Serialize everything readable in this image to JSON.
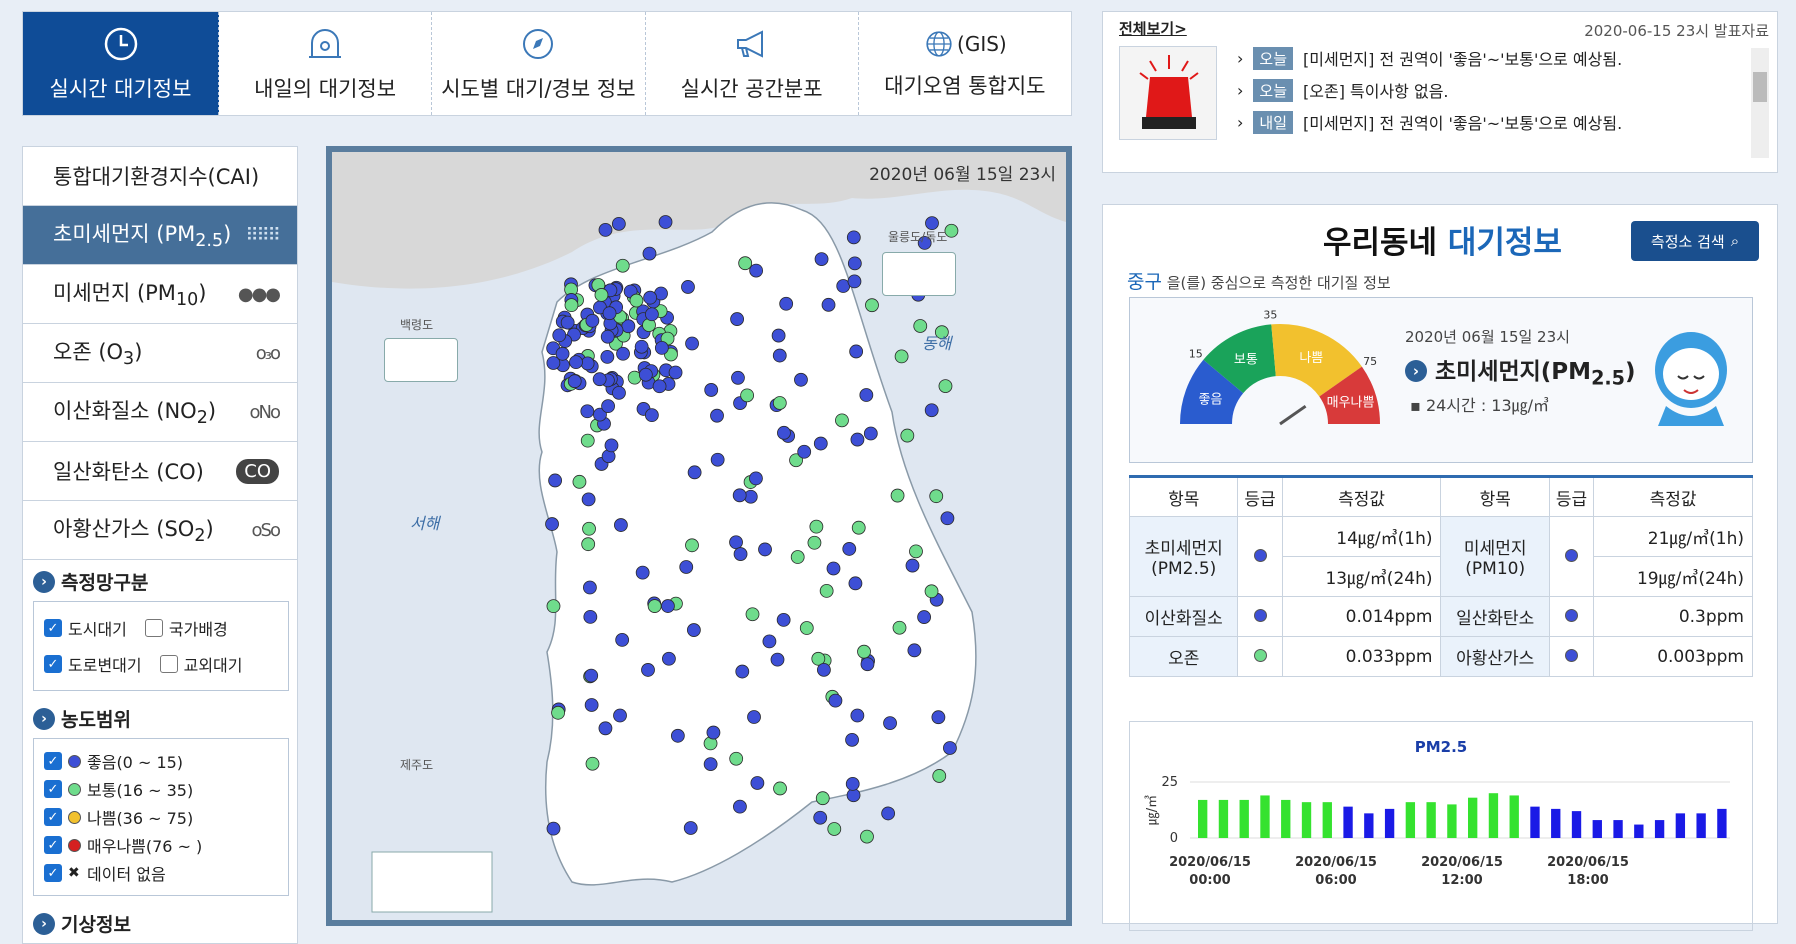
{
  "tabs": [
    {
      "label": "실시간 대기정보",
      "icon": "clock-icon"
    },
    {
      "label": "내일의 대기정보",
      "icon": "dome-icon"
    },
    {
      "label": "시도별 대기/경보 정보",
      "icon": "compass-icon"
    },
    {
      "label": "실시간 공간분포",
      "icon": "megaphone-icon"
    },
    {
      "label": "대기오염 통합지도",
      "icon": "globe-icon",
      "prefix": "(GIS)"
    }
  ],
  "menu": [
    {
      "label": "통합대기환경지수(CAI)",
      "icon": ""
    },
    {
      "label": "초미세먼지 (PM",
      "sub": "2.5",
      "suffix": ")",
      "icon": "⠿⠿⠿"
    },
    {
      "label": "미세먼지 (PM",
      "sub": "10",
      "suffix": ")",
      "icon": "●●●"
    },
    {
      "label": "오존 (O",
      "sub": "3",
      "suffix": ")",
      "icon": "o₃o"
    },
    {
      "label": "이산화질소 (NO",
      "sub": "2",
      "suffix": ")",
      "icon": "oNo"
    },
    {
      "label": "일산화탄소 (CO)",
      "sub": "",
      "suffix": "",
      "icon": "CO"
    },
    {
      "label": "아황산가스 (SO",
      "sub": "2",
      "suffix": ")",
      "icon": "oSo"
    }
  ],
  "network": {
    "title": "측정망구분",
    "items": [
      {
        "label": "도시대기",
        "checked": true
      },
      {
        "label": "국가배경",
        "checked": false
      },
      {
        "label": "도로변대기",
        "checked": true
      },
      {
        "label": "교외대기",
        "checked": false
      }
    ]
  },
  "range": {
    "title": "농도범위",
    "items": [
      {
        "label": "좋음(0 ~ 15)",
        "color": "#3d4fd6"
      },
      {
        "label": "보통(16 ~ 35)",
        "color": "#6fdc8c"
      },
      {
        "label": "나쁨(36 ~ 75)",
        "color": "#f2c12e"
      },
      {
        "label": "매우나쁨(76 ~ )",
        "color": "#d42020"
      },
      {
        "label": "데이터 없음",
        "color": "none"
      }
    ]
  },
  "weather_title": "기상정보",
  "map": {
    "date": "2020년 06월 15일 23시",
    "ulleung": "울릉도/독도",
    "baengnyeong": "백령도",
    "jeju": "제주도",
    "east_sea": "동해",
    "west_sea": "서해"
  },
  "news": {
    "header": "전체보기>",
    "published": "2020-06-15 23시 발표자료",
    "items": [
      {
        "tag": "오늘",
        "text": "[미세먼지] 전 권역이 '좋음'~'보통'으로 예상됨."
      },
      {
        "tag": "오늘",
        "text": "[오존] 특이사항 없음."
      },
      {
        "tag": "내일",
        "text": "[미세먼지] 전 권역이 '좋음'~'보통'으로 예상됨."
      }
    ]
  },
  "local": {
    "title_a": "우리동네 ",
    "title_b": "대기정보",
    "search_label": "측정소 검색",
    "district": "중구",
    "subtitle": " 을(를) 중심으로 측정한 대기질 정보",
    "gauge": {
      "labels": [
        "좋음",
        "보통",
        "나쁨",
        "매우나쁨"
      ],
      "ticks": [
        "15",
        "35",
        "75"
      ],
      "date": "2020년 06월 15일 23시",
      "item": "초미세먼지(PM",
      "item_sub": "2.5",
      "item_suffix": ")",
      "avg": "24시간 : 13㎍/㎥"
    },
    "table": {
      "headers": [
        "항목",
        "등급",
        "측정값",
        "항목",
        "등급",
        "측정값"
      ],
      "rows": [
        {
          "n1": "초미세먼지",
          "n1s": "(PM2.5)",
          "g1": "#3d4fd6",
          "v1a": "14㎍/㎥(1h)",
          "v1b": "13㎍/㎥(24h)",
          "n2": "미세먼지",
          "n2s": "(PM10)",
          "g2": "#3d4fd6",
          "v2a": "21㎍/㎥(1h)",
          "v2b": "19㎍/㎥(24h)"
        },
        {
          "n1": "이산화질소",
          "g1": "#3d4fd6",
          "v1a": "0.014ppm",
          "n2": "일산화탄소",
          "g2": "#3d4fd6",
          "v2a": "0.3ppm"
        },
        {
          "n1": "오존",
          "g1": "#6fdc8c",
          "v1a": "0.033ppm",
          "n2": "아황산가스",
          "g2": "#3d4fd6",
          "v2a": "0.003ppm"
        }
      ]
    }
  },
  "chart_data": {
    "type": "bar",
    "title": "PM2.5",
    "ylabel": "㎍/㎥",
    "ylim": [
      0,
      25
    ],
    "yticks": [
      "25",
      "0"
    ],
    "xlabels": [
      "2020/06/15\n00:00",
      "2020/06/15\n06:00",
      "2020/06/15\n12:00",
      "2020/06/15\n18:00"
    ],
    "values": [
      17,
      17,
      17,
      19,
      17,
      16,
      16,
      14,
      11,
      13,
      16,
      16,
      15,
      18,
      20,
      19,
      14,
      13,
      12,
      8,
      8,
      6,
      8,
      11,
      11,
      13
    ],
    "colors": [
      "#35e22f",
      "#35e22f",
      "#35e22f",
      "#35e22f",
      "#35e22f",
      "#35e22f",
      "#35e22f",
      "#1a1ae6",
      "#1a1ae6",
      "#1a1ae6",
      "#35e22f",
      "#35e22f",
      "#35e22f",
      "#35e22f",
      "#35e22f",
      "#35e22f",
      "#1a1ae6",
      "#1a1ae6",
      "#1a1ae6",
      "#1a1ae6",
      "#1a1ae6",
      "#1a1ae6",
      "#1a1ae6",
      "#1a1ae6",
      "#1a1ae6",
      "#1a1ae6"
    ]
  }
}
